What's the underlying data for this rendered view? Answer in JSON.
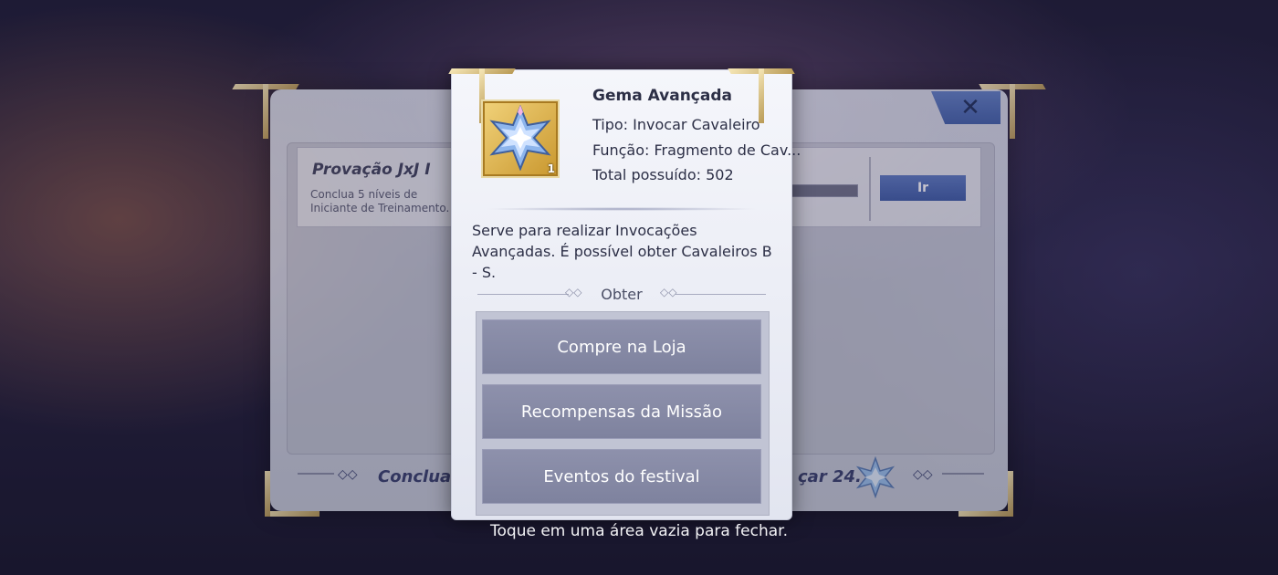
{
  "quest": {
    "title": "Provação JxJ I",
    "description": "Conclua 5 níveis de Iniciante de Treinamento.",
    "go_label": "Ir"
  },
  "footer": {
    "left_text": "Conclua to",
    "right_text": "çar 24."
  },
  "item": {
    "name": "Gema Avançada",
    "type": "Tipo: Invocar Cavaleiro",
    "function": "Função: Fragmento de Cav...",
    "owned": "Total possuído: 502",
    "count": "1",
    "description": "Serve para realizar Invocações Avançadas. É possível obter Cavaleiros B - S."
  },
  "obtain": {
    "title": "Obter",
    "sources": [
      "Compre na Loja",
      "Recompensas da Missão",
      "Eventos do festival"
    ]
  },
  "hint": "Toque em uma área vazia para fechar.",
  "icons": [
    "close-icon",
    "gem-icon",
    "star-gem-icon"
  ]
}
